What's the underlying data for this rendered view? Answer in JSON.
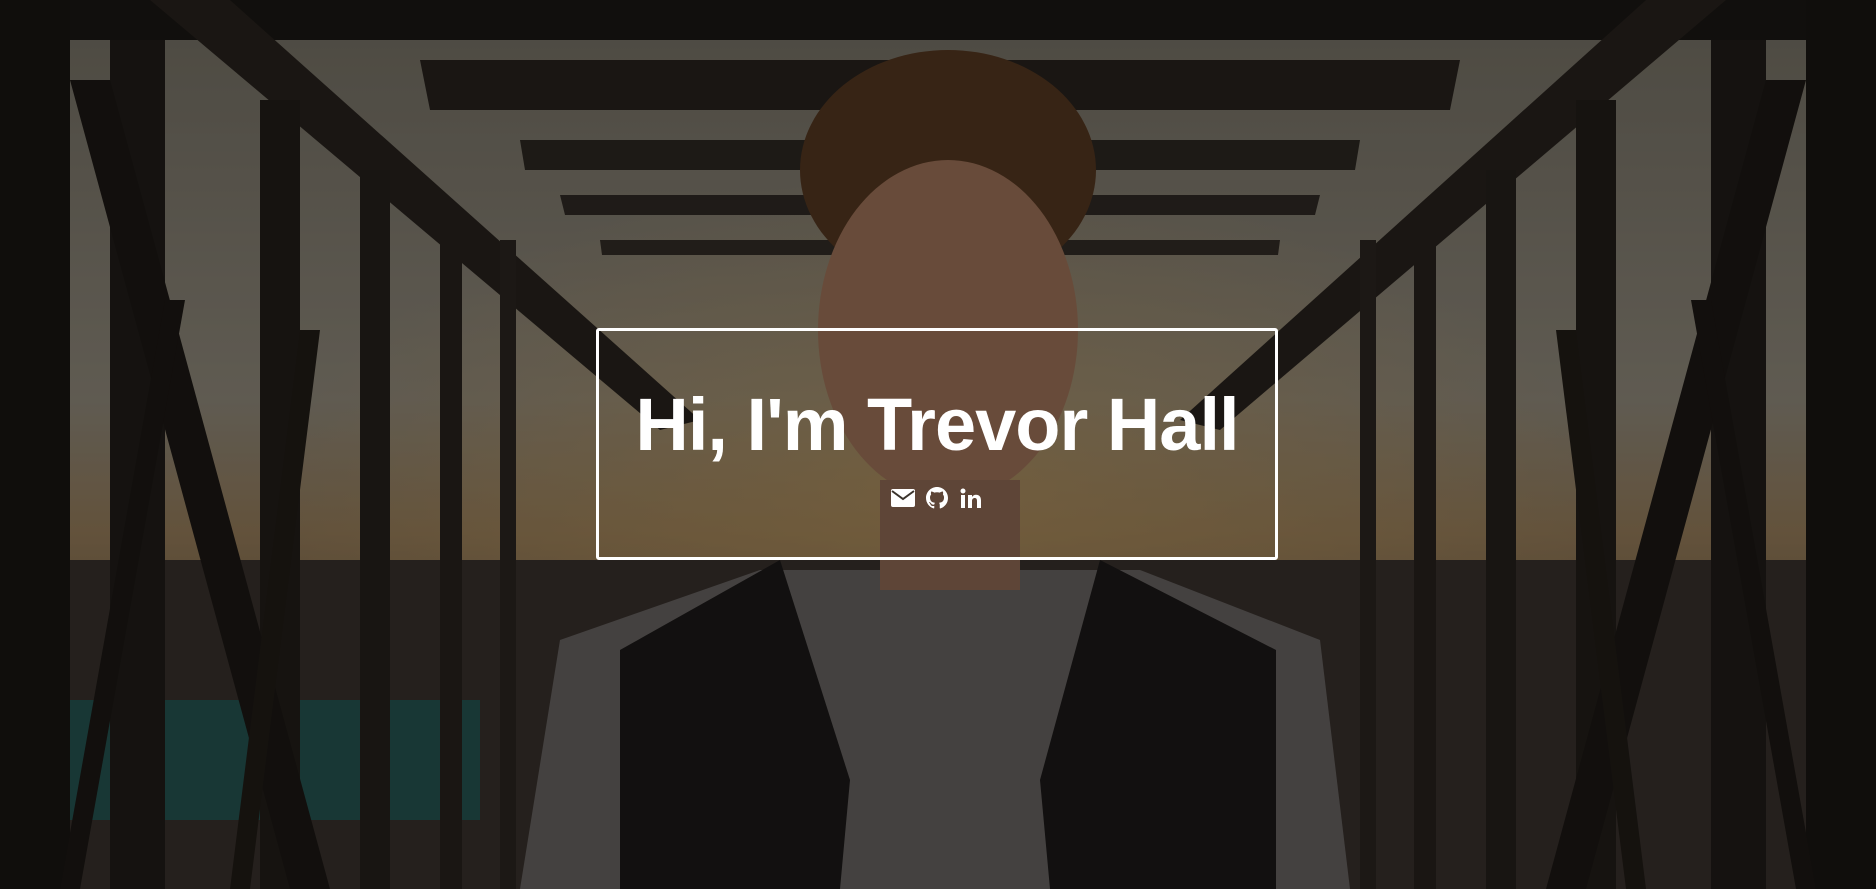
{
  "hero": {
    "title": "Hi, I'm Trevor Hall",
    "background_description_colors": {
      "sky": "#8b8678",
      "steel": "#2a2520",
      "accent_teal": "#1f6a66"
    },
    "overlay_color": "rgba(0,0,0,0.38)",
    "border_color": "#ffffff",
    "text_color": "#ffffff"
  },
  "socials": [
    {
      "icon": "envelope-icon",
      "label": "Email"
    },
    {
      "icon": "github-icon",
      "label": "GitHub"
    },
    {
      "icon": "linkedin-icon",
      "label": "LinkedIn"
    }
  ]
}
